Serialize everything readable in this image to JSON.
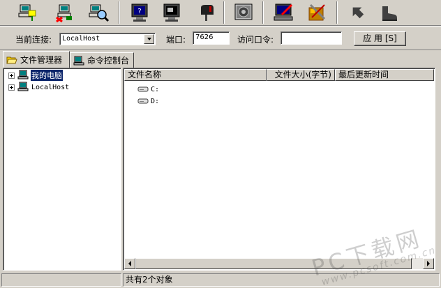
{
  "toolbar": {
    "buttons": [
      {
        "icon": "network-computer-icon"
      },
      {
        "icon": "disconnect-computer-icon"
      },
      {
        "icon": "search-computer-icon"
      },
      {
        "icon": "help-monitor-icon"
      },
      {
        "icon": "screen-capture-icon"
      },
      {
        "icon": "mailbox-icon"
      },
      {
        "icon": "video-capture-icon"
      },
      {
        "icon": "remote-edit-icon"
      },
      {
        "icon": "settings-tools-icon"
      },
      {
        "icon": "back-arrow-icon"
      },
      {
        "icon": "boot-icon"
      }
    ]
  },
  "connection": {
    "label": "当前连接:",
    "selected": "LocalHost",
    "port_label": "端口:",
    "port_value": "7626",
    "password_label": "访问口令:",
    "password_value": "",
    "apply_label": "应 用 [S]"
  },
  "tabs": [
    {
      "label": "文件管理器",
      "icon": "folder-open-icon",
      "active": true
    },
    {
      "label": "命令控制台",
      "icon": "console-computer-icon",
      "active": false
    }
  ],
  "tree": {
    "items": [
      {
        "label": "我的电脑",
        "selected": true,
        "icon": "my-computer-icon"
      },
      {
        "label": "LocalHost",
        "selected": false,
        "icon": "computer-icon"
      }
    ]
  },
  "list": {
    "columns": [
      "文件名称",
      "文件大小(字节)",
      "最后更新时间"
    ],
    "rows": [
      {
        "name": "C:",
        "icon": "drive-icon"
      },
      {
        "name": "D:",
        "icon": "drive-icon"
      }
    ]
  },
  "status": {
    "left": "",
    "message": "共有2个对象"
  },
  "watermark": {
    "line1": "PC下载网",
    "line2": "www.pcsoft.com.cn"
  }
}
